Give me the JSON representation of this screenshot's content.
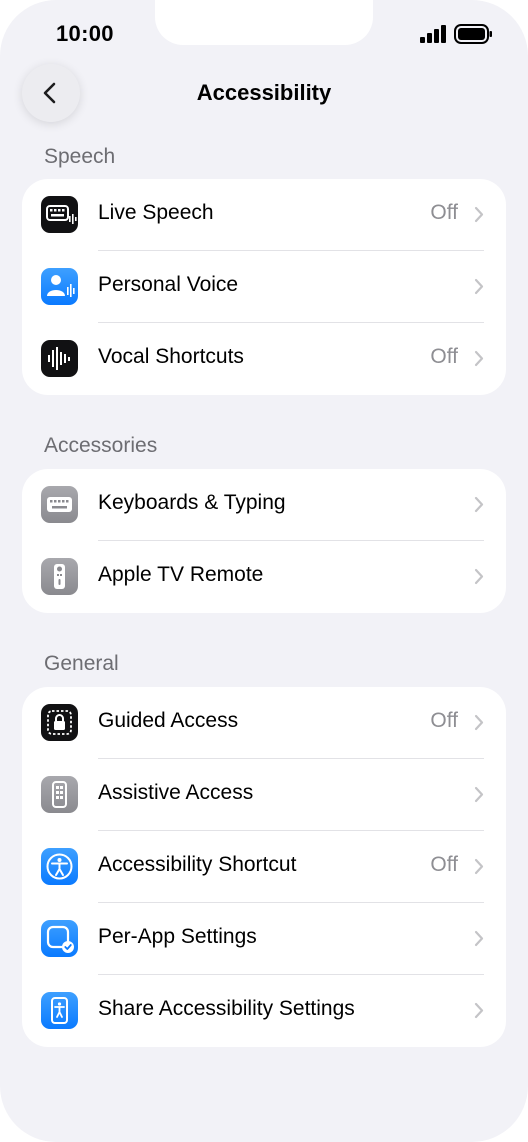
{
  "status_bar": {
    "time": "10:00"
  },
  "nav": {
    "title": "Accessibility"
  },
  "sections": [
    {
      "header": "Speech",
      "items": [
        {
          "label": "Live Speech",
          "value": "Off"
        },
        {
          "label": "Personal Voice",
          "value": ""
        },
        {
          "label": "Vocal Shortcuts",
          "value": "Off"
        }
      ]
    },
    {
      "header": "Accessories",
      "items": [
        {
          "label": "Keyboards & Typing",
          "value": ""
        },
        {
          "label": "Apple TV Remote",
          "value": ""
        }
      ]
    },
    {
      "header": "General",
      "items": [
        {
          "label": "Guided Access",
          "value": "Off"
        },
        {
          "label": "Assistive Access",
          "value": ""
        },
        {
          "label": "Accessibility Shortcut",
          "value": "Off"
        },
        {
          "label": "Per-App Settings",
          "value": ""
        },
        {
          "label": "Share Accessibility Settings",
          "value": ""
        }
      ]
    }
  ],
  "colors": {
    "background": "#f2f2f7",
    "secondary_text": "#8e8e93",
    "accent_blue": "#0a7aff"
  }
}
